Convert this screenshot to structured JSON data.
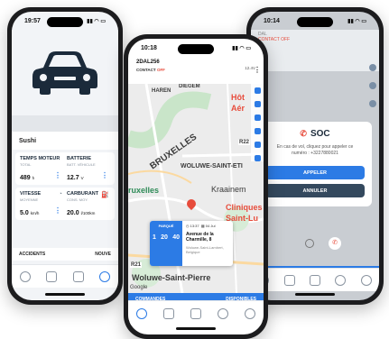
{
  "left_phone": {
    "time": "19:57",
    "vehicle_name": "Sushi",
    "metrics": [
      {
        "title": "TEMPS MOTEUR",
        "subtitle": "TOTAL",
        "value": "489",
        "unit": "h"
      },
      {
        "title": "BATTERIE",
        "subtitle": "BATT. VÉHICULE",
        "value": "12.7",
        "unit": "V"
      },
      {
        "title": "VITESSE",
        "subtitle": "MOYENNE",
        "value": "5.0",
        "unit": "km/h"
      },
      {
        "title": "CARBURANT",
        "subtitle": "CONS. MOY.",
        "value": "20.0",
        "unit": "l/100km"
      }
    ],
    "accidents_label": "ACCIDENTS",
    "accidents_right": "NOUVE"
  },
  "center_phone": {
    "time": "10:18",
    "plate": "2DAL256",
    "contact_label": "CONTACT",
    "contact_state": "OFF",
    "meta": "12.4V",
    "map_labels": {
      "haren": "HAREN",
      "diegem": "DIEGEM",
      "bruxelles": "BRUXELLES",
      "woluwe_saint_etienne": "WOLUWE-SAINT-ETI",
      "kraainem": "Kraainem",
      "cliniques": "Cliniques",
      "saint_luc": "Saint-Lu",
      "woluwe_saint_pierre": "Woluwe-Saint-Pierre",
      "bruxelles_green": "ruxelles",
      "hot": "Hôt",
      "aero": "Aér",
      "r22": "R22",
      "r21": "R21",
      "google": "Google"
    },
    "popup": {
      "status": "PARQUÉ",
      "time": "13:37",
      "date": "04 Jul",
      "duration": [
        "1",
        "20",
        "40"
      ],
      "address": "Avenue de la Charmille, 8",
      "city": "Woluwe-Saint-Lambert, Belgique"
    },
    "commands_label": "COMMANDES",
    "commands_right": "DISPONIBLES"
  },
  "right_phone": {
    "time": "10:14",
    "top_small": "DAL",
    "top_contact": "CONTACT OFF",
    "soc": {
      "title": "SOC",
      "message": "En cas de vol, cliquez pour appeler ce numéro : +3227880021",
      "call_button": "APPELER",
      "cancel_button": "ANNULER"
    },
    "commands_label": "COMMANDES",
    "commands_right": "DISPONIBLES"
  }
}
